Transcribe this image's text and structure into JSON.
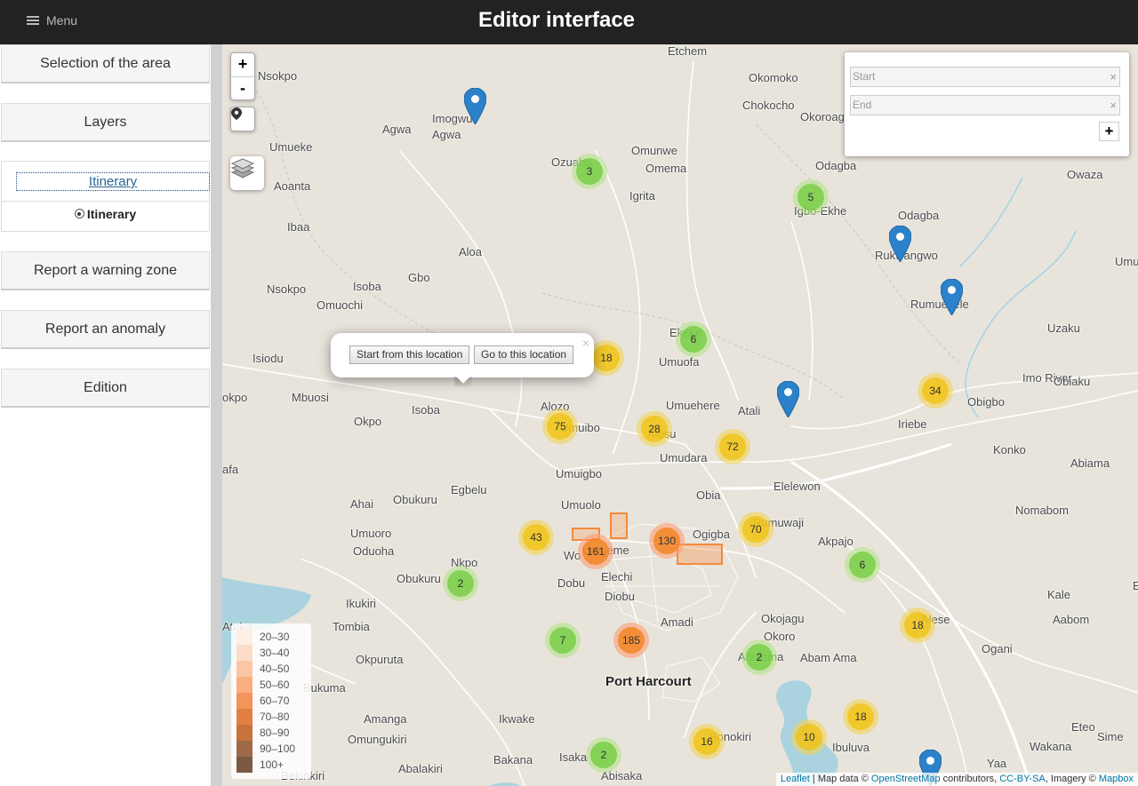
{
  "header": {
    "menu_label": "Menu",
    "title": "Editor interface"
  },
  "sidebar": {
    "selection_label": "Selection of the area",
    "layers_label": "Layers",
    "itinerary_header": "Itinerary",
    "itinerary_option": "Itinerary",
    "warning_zone_label": "Report a warning zone",
    "anomaly_label": "Report an anomaly",
    "edition_label": "Edition"
  },
  "map_controls": {
    "zoom_in": "+",
    "zoom_out": "-"
  },
  "routing": {
    "start_placeholder": "Start",
    "end_placeholder": "End",
    "clear_symbol": "×",
    "add_waypoint": "+"
  },
  "popup": {
    "start_button": "Start from this location",
    "goto_button": "Go to this location",
    "close_symbol": "×"
  },
  "places": [
    "Nsokpo",
    "Imogwu-",
    "Agwa",
    "Agwa",
    "Umueke",
    "Aoanta",
    "Ibaa",
    "Aloa",
    "Gbo",
    "Isoba",
    "Nsokpo",
    "Omuochi",
    "Isiodu",
    "Mbuosi",
    "okpo",
    "Okpo",
    "Isoba",
    "Alozo",
    "Umuibo",
    "afa",
    "Umuigbo",
    "Ahai",
    "Obukuru",
    "Egbelu",
    "Umuolo",
    "Umuoro",
    "Oduoha",
    "Nkpo",
    "Obukuru",
    "Wo",
    "Umueme",
    "Dobu",
    "Elechi",
    "Diobu",
    "Ikukiri",
    "Atuka",
    "Tombia",
    "Okpuruta",
    "Amadi",
    "Bukuma",
    "Amanga",
    "Omungukiri",
    "Ikwake",
    "Abalakiri",
    "Bakana",
    "Isaka",
    "Abisaka",
    "Bekinkiri",
    "Okomoko",
    "Chokocho",
    "Okoroag",
    "Ozuaha",
    "Omunwe",
    "Omema",
    "Igrita",
    "Odagba",
    "Igbo-Ekhe",
    "Odagba",
    "Rukwangwo",
    "Owaza",
    "Umu",
    "Rumuekele",
    "Uzaku",
    "Ekeke",
    "Umuofa",
    "Umuehere",
    "Atali",
    "Imo River",
    "Obiaku",
    "Obigbo",
    "Iriebe",
    "Alosu",
    "Umudara",
    "Konko",
    "Abiama",
    "Obia",
    "Elelewon",
    "Nomabom",
    "Rumuwaji",
    "Ogigba",
    "Akpajo",
    "Okojagu",
    "Okoro",
    "Abuloma",
    "Abam Ama",
    "Kale",
    "Aabom",
    "Alese",
    "Ogani",
    "Bonokiri",
    "Ibuluva",
    "Wakana",
    "Eteo",
    "Sime",
    "Yaa",
    "Etchem",
    "E",
    "Port Harcourt"
  ],
  "clusters": [
    {
      "count": "3",
      "level": "green"
    },
    {
      "count": "5",
      "level": "green"
    },
    {
      "count": "6",
      "level": "green"
    },
    {
      "count": "18",
      "level": "yellow"
    },
    {
      "count": "34",
      "level": "yellow"
    },
    {
      "count": "75",
      "level": "yellow"
    },
    {
      "count": "28",
      "level": "yellow"
    },
    {
      "count": "72",
      "level": "yellow"
    },
    {
      "count": "43",
      "level": "yellow"
    },
    {
      "count": "161",
      "level": "orange"
    },
    {
      "count": "130",
      "level": "orange"
    },
    {
      "count": "70",
      "level": "yellow"
    },
    {
      "count": "6",
      "level": "green"
    },
    {
      "count": "2",
      "level": "green"
    },
    {
      "count": "7",
      "level": "green"
    },
    {
      "count": "185",
      "level": "orange"
    },
    {
      "count": "2",
      "level": "green"
    },
    {
      "count": "18",
      "level": "yellow"
    },
    {
      "count": "18",
      "level": "yellow"
    },
    {
      "count": "10",
      "level": "yellow"
    },
    {
      "count": "16",
      "level": "yellow"
    },
    {
      "count": "2",
      "level": "green"
    }
  ],
  "legend": [
    {
      "label": "20–30",
      "color": "#fdeee6"
    },
    {
      "label": "30–40",
      "color": "#fcdcc8"
    },
    {
      "label": "40–50",
      "color": "#fbc6a5"
    },
    {
      "label": "50–60",
      "color": "#f9ae80"
    },
    {
      "label": "60–70",
      "color": "#f3945b"
    },
    {
      "label": "70–80",
      "color": "#e47f42"
    },
    {
      "label": "80–90",
      "color": "#c9733c"
    },
    {
      "label": "90–100",
      "color": "#9f6a47"
    },
    {
      "label": "100+",
      "color": "#7a5a44"
    }
  ],
  "attribution": {
    "leaflet": "Leaflet",
    "map_data": " | Map data © ",
    "osm": "OpenStreetMap",
    "contributors": " contributors, ",
    "ccbysa": "CC-BY-SA",
    "imagery": ", Imagery © ",
    "mapbox": "Mapbox"
  },
  "colors": {
    "header_bg": "#222222",
    "map_bg": "#e8e4dc",
    "marker_blue": "#2b82cb",
    "warning_zone": "#f28a3c"
  }
}
